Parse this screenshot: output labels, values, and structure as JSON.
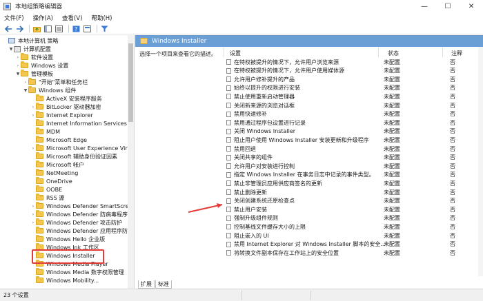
{
  "window": {
    "title": "本地组策略编辑器",
    "minimize": "—",
    "maximize": "☐",
    "close": "✕"
  },
  "menu": [
    "文件(F)",
    "操作(A)",
    "查看(V)",
    "帮助(H)"
  ],
  "toolbar": {
    "back_icon": "arrow-left-icon",
    "forward_icon": "arrow-right-icon",
    "up_icon": "folder-up-icon",
    "show_hide_icon": "tree-toggle-icon",
    "export_icon": "export-icon",
    "help_icon": "help-icon",
    "properties_icon": "properties-icon",
    "filter_icon": "filter-icon"
  },
  "tree": {
    "items": [
      {
        "label": "本地计算机 策略",
        "level": 0,
        "arrow": "",
        "icon": "pc"
      },
      {
        "label": "计算机配置",
        "level": 1,
        "arrow": "▼",
        "icon": "cfg"
      },
      {
        "label": "软件设置",
        "level": 2,
        "arrow": "›",
        "icon": "folder"
      },
      {
        "label": "Windows 设置",
        "level": 2,
        "arrow": "›",
        "icon": "folder"
      },
      {
        "label": "管理模板",
        "level": 2,
        "arrow": "▼",
        "icon": "folder"
      },
      {
        "label": "\"开始\"菜单和任务栏",
        "level": 3,
        "arrow": "›",
        "icon": "folder"
      },
      {
        "label": "Windows 组件",
        "level": 3,
        "arrow": "▼",
        "icon": "folder"
      },
      {
        "label": "ActiveX 安装程序服务",
        "level": 4,
        "arrow": "",
        "icon": "folder"
      },
      {
        "label": "BitLocker 驱动器加密",
        "level": 4,
        "arrow": "›",
        "icon": "folder"
      },
      {
        "label": "Internet Explorer",
        "level": 4,
        "arrow": "›",
        "icon": "folder"
      },
      {
        "label": "Internet Information Services",
        "level": 4,
        "arrow": "",
        "icon": "folder"
      },
      {
        "label": "MDM",
        "level": 4,
        "arrow": "",
        "icon": "folder"
      },
      {
        "label": "Microsoft Edge",
        "level": 4,
        "arrow": "",
        "icon": "folder"
      },
      {
        "label": "Microsoft User Experience Virtual",
        "level": 4,
        "arrow": "›",
        "icon": "folder"
      },
      {
        "label": "Microsoft 辅助身份验证因素",
        "level": 4,
        "arrow": "",
        "icon": "folder"
      },
      {
        "label": "Microsoft 帐户",
        "level": 4,
        "arrow": "",
        "icon": "folder"
      },
      {
        "label": "NetMeeting",
        "level": 4,
        "arrow": "",
        "icon": "folder"
      },
      {
        "label": "OneDrive",
        "level": 4,
        "arrow": "",
        "icon": "folder"
      },
      {
        "label": "OOBE",
        "level": 4,
        "arrow": "",
        "icon": "folder"
      },
      {
        "label": "RSS 源",
        "level": 4,
        "arrow": "",
        "icon": "folder"
      },
      {
        "label": "Windows Defender SmartScreen",
        "level": 4,
        "arrow": "›",
        "icon": "folder"
      },
      {
        "label": "Windows Defender 防病毒程序",
        "level": 4,
        "arrow": "›",
        "icon": "folder"
      },
      {
        "label": "Windows Defender 攻击防护",
        "level": 4,
        "arrow": "›",
        "icon": "folder"
      },
      {
        "label": "Windows Defender 应用程序防护",
        "level": 4,
        "arrow": "",
        "icon": "folder"
      },
      {
        "label": "Windows Hello 企业版",
        "level": 4,
        "arrow": "",
        "icon": "folder"
      },
      {
        "label": "Windows Ink 工作区",
        "level": 4,
        "arrow": "",
        "icon": "folder"
      },
      {
        "label": "Windows Installer",
        "level": 4,
        "arrow": "",
        "icon": "folder"
      },
      {
        "label": "Windows Media Player",
        "level": 4,
        "arrow": "",
        "icon": "folder"
      },
      {
        "label": "Windows Media 数字权限管理",
        "level": 4,
        "arrow": "",
        "icon": "folder"
      },
      {
        "label": "Windows Mobility...",
        "level": 4,
        "arrow": "",
        "icon": "folder"
      }
    ]
  },
  "right": {
    "header": "Windows Installer",
    "description": "选择一个项目来查看它的描述。",
    "columns": {
      "setting": "设置",
      "state": "状态",
      "note": "注释"
    },
    "rows": [
      {
        "text": "在特权被提升的情况下，允许用户浏览来源",
        "state": "未配置",
        "note": "否"
      },
      {
        "text": "在特权被提升的情况下，允许用户使用媒体源",
        "state": "未配置",
        "note": "否"
      },
      {
        "text": "允许用户修补提升的产品",
        "state": "未配置",
        "note": "否"
      },
      {
        "text": "始终以提升的权限进行安装",
        "state": "未配置",
        "note": "否"
      },
      {
        "text": "禁止使用重新启动管理器",
        "state": "未配置",
        "note": "否"
      },
      {
        "text": "关闭新来源的浏览对话框",
        "state": "未配置",
        "note": "否"
      },
      {
        "text": "禁用快速修补",
        "state": "未配置",
        "note": "否"
      },
      {
        "text": "禁用通过程序包设置进行记录",
        "state": "未配置",
        "note": "否"
      },
      {
        "text": "关闭 Windows Installer",
        "state": "未配置",
        "note": "否"
      },
      {
        "text": "阻止用户使用 Windows Installer 安装更新和升级程序",
        "state": "未配置",
        "note": "否"
      },
      {
        "text": "禁用回退",
        "state": "未配置",
        "note": "否"
      },
      {
        "text": "关闭共享的组件",
        "state": "未配置",
        "note": "否"
      },
      {
        "text": "允许用户对安装进行控制",
        "state": "未配置",
        "note": "否"
      },
      {
        "text": "指定 Windows Installer 在事务日志中记录的事件类型。",
        "state": "未配置",
        "note": "否"
      },
      {
        "text": "禁止非管理员应用供应商签名的更新",
        "state": "未配置",
        "note": "否"
      },
      {
        "text": "禁止删除更新",
        "state": "未配置",
        "note": "否"
      },
      {
        "text": "关闭创建系统还原检查点",
        "state": "未配置",
        "note": "否"
      },
      {
        "text": "禁止用户安装",
        "state": "未配置",
        "note": "否"
      },
      {
        "text": "强制升级组件规则",
        "state": "未配置",
        "note": "否"
      },
      {
        "text": "控制基线文件缓存大小的上限",
        "state": "未配置",
        "note": "否"
      },
      {
        "text": "阻止嵌入的 UI",
        "state": "未配置",
        "note": "否"
      },
      {
        "text": "禁用 Internet Explorer 对 Windows Installer 脚本的安全...",
        "state": "未配置",
        "note": "否"
      },
      {
        "text": "将转换文件副本保存在工作站上的安全位置",
        "state": "未配置",
        "note": "否"
      }
    ],
    "tabs": [
      "扩展",
      "标准"
    ]
  },
  "status": {
    "text": "23 个设置"
  },
  "colors": {
    "header_blue": "#6a9fd6",
    "highlight_red": "#e53935",
    "folder_yellow": "#f2c64f"
  }
}
